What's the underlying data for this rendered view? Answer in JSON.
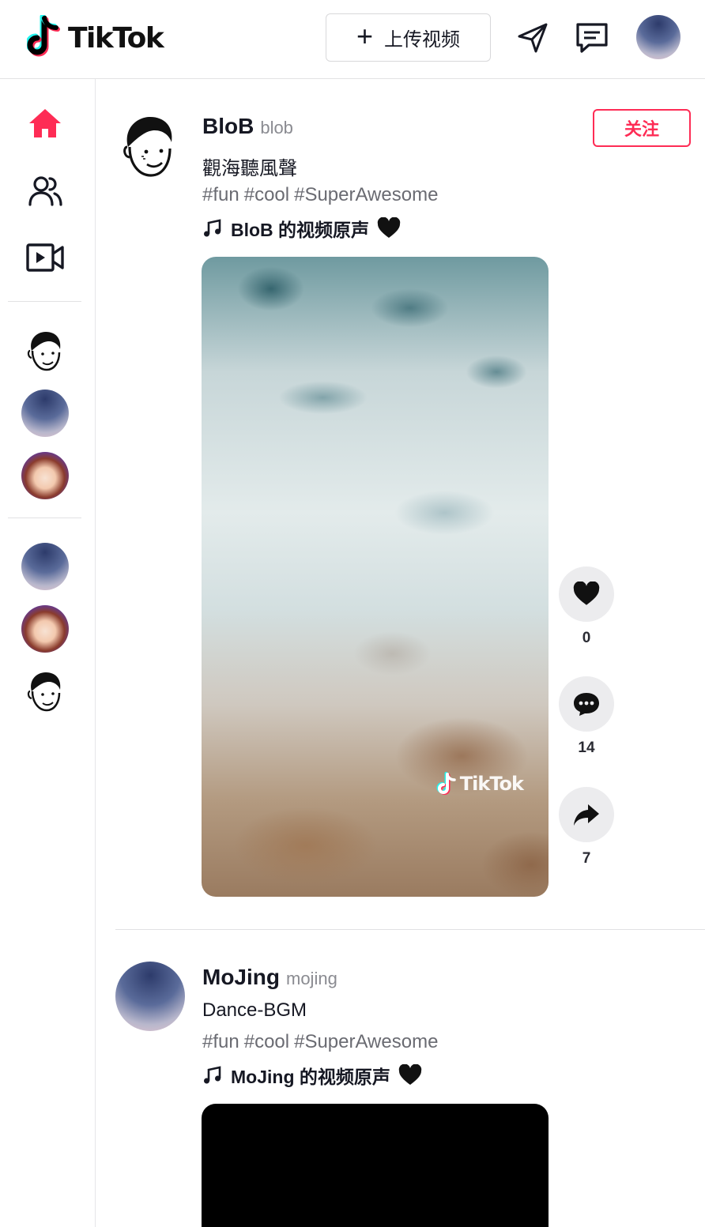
{
  "header": {
    "logo_text": "TikTok",
    "upload_label": "上传视频",
    "icons": [
      "send-icon",
      "message-icon"
    ]
  },
  "sidebar": {
    "nav": [
      {
        "icon": "home-icon",
        "active": true
      },
      {
        "icon": "following-icon",
        "active": false
      },
      {
        "icon": "live-video-icon",
        "active": false
      }
    ]
  },
  "colors": {
    "accent": "#fe2c55",
    "text": "#161823",
    "muted": "#8a8b91"
  },
  "posts": [
    {
      "author": "BloB",
      "handle": "blob",
      "caption": "觀海聽風聲",
      "tags": [
        "#fun",
        "#cool",
        "#SuperAwesome"
      ],
      "music": "BloB 的视频原声",
      "follow_label": "关注",
      "watermark": "TikTok",
      "likes": "0",
      "comments": "14",
      "shares": "7"
    },
    {
      "author": "MoJing",
      "handle": "mojing",
      "caption": "Dance-BGM",
      "tags": [
        "#fun",
        "#cool",
        "#SuperAwesome"
      ],
      "music": "MoJing 的视频原声"
    }
  ]
}
